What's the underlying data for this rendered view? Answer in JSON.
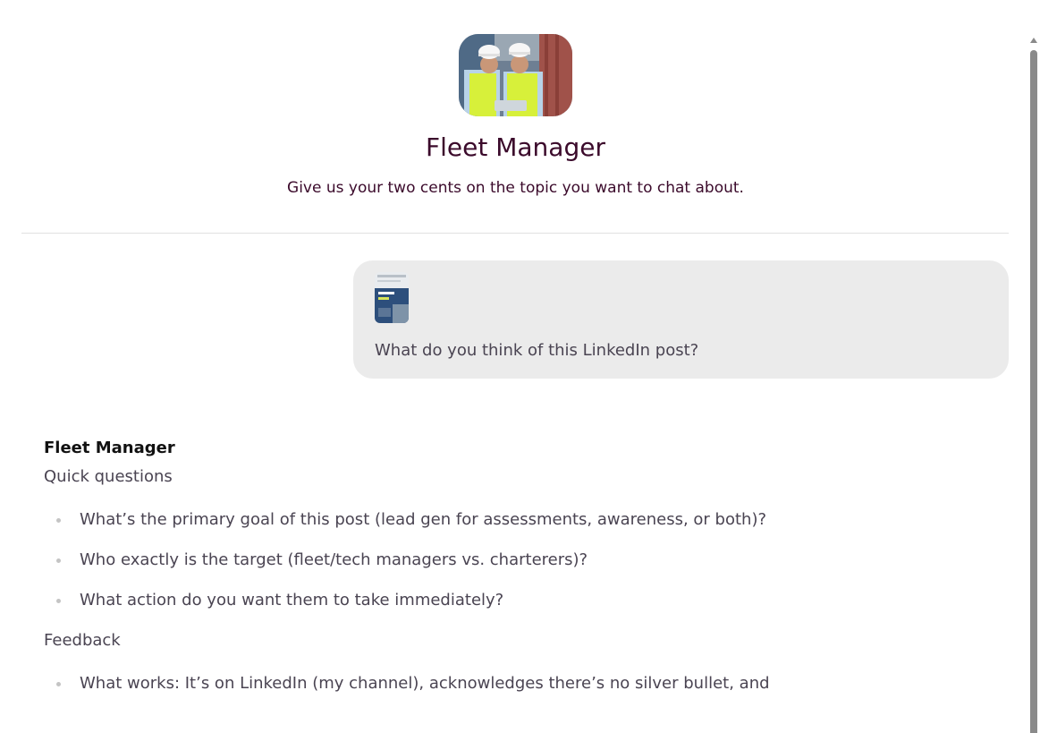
{
  "header": {
    "avatar_icon": "construction-workers-photo",
    "title": "Fleet Manager",
    "subtitle": "Give us your two cents on the topic you want to chat about."
  },
  "user_message": {
    "attachment_icon": "linkedin-post-thumbnail",
    "text": "What do you think of this LinkedIn post?"
  },
  "assistant": {
    "name": "Fleet Manager",
    "intro": "Quick questions",
    "questions": [
      "What’s the primary goal of this post (lead gen for assessments, awareness, or both)?",
      "Who exactly is the target (fleet/tech managers vs. charterers)?",
      "What action do you want them to take immediately?"
    ],
    "section2_heading": "Feedback",
    "feedback": [
      "What works: It’s on LinkedIn (my channel), acknowledges there’s no silver bullet, and"
    ]
  },
  "colors": {
    "title": "#3b0a2b",
    "bubble_bg": "#ebebeb",
    "body_text": "#4a4452"
  }
}
